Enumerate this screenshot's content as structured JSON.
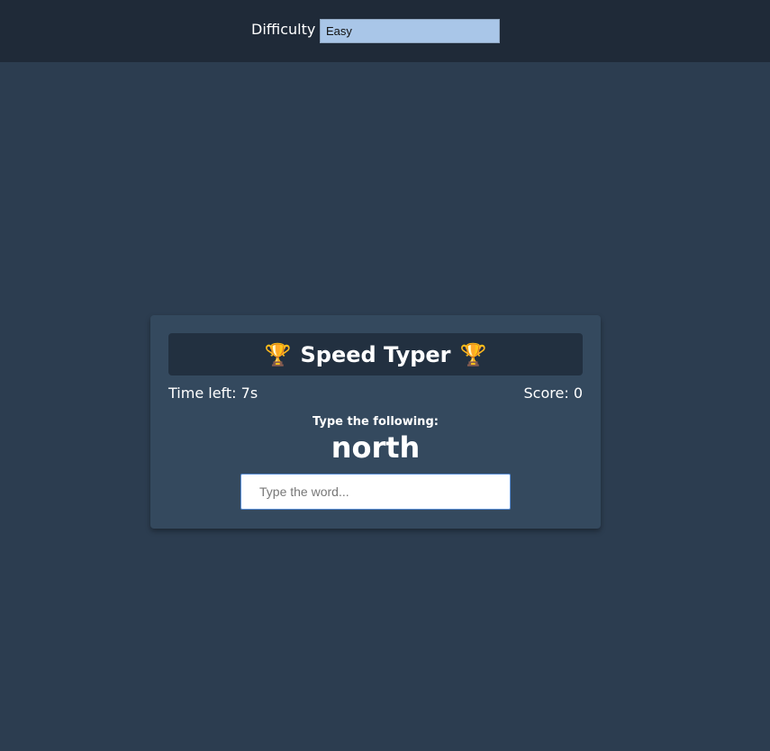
{
  "settings": {
    "difficulty_label": "Difficulty",
    "difficulty_value": "Easy"
  },
  "game": {
    "title": "Speed Typer",
    "title_icon": "trophy-icon",
    "time_left_label": "Time left:",
    "time_left_value": "7s",
    "score_label": "Score:",
    "score_value": "0",
    "prompt_label": "Type the following:",
    "current_word": "north",
    "input_placeholder": "Type the word...",
    "input_value": ""
  },
  "colors": {
    "background": "#2c3d50",
    "settings_bar": "#1f2a38",
    "card": "#34495e",
    "title_box": "#223040",
    "select_bg": "#a9c6e8",
    "trophy": "#f0b429"
  }
}
